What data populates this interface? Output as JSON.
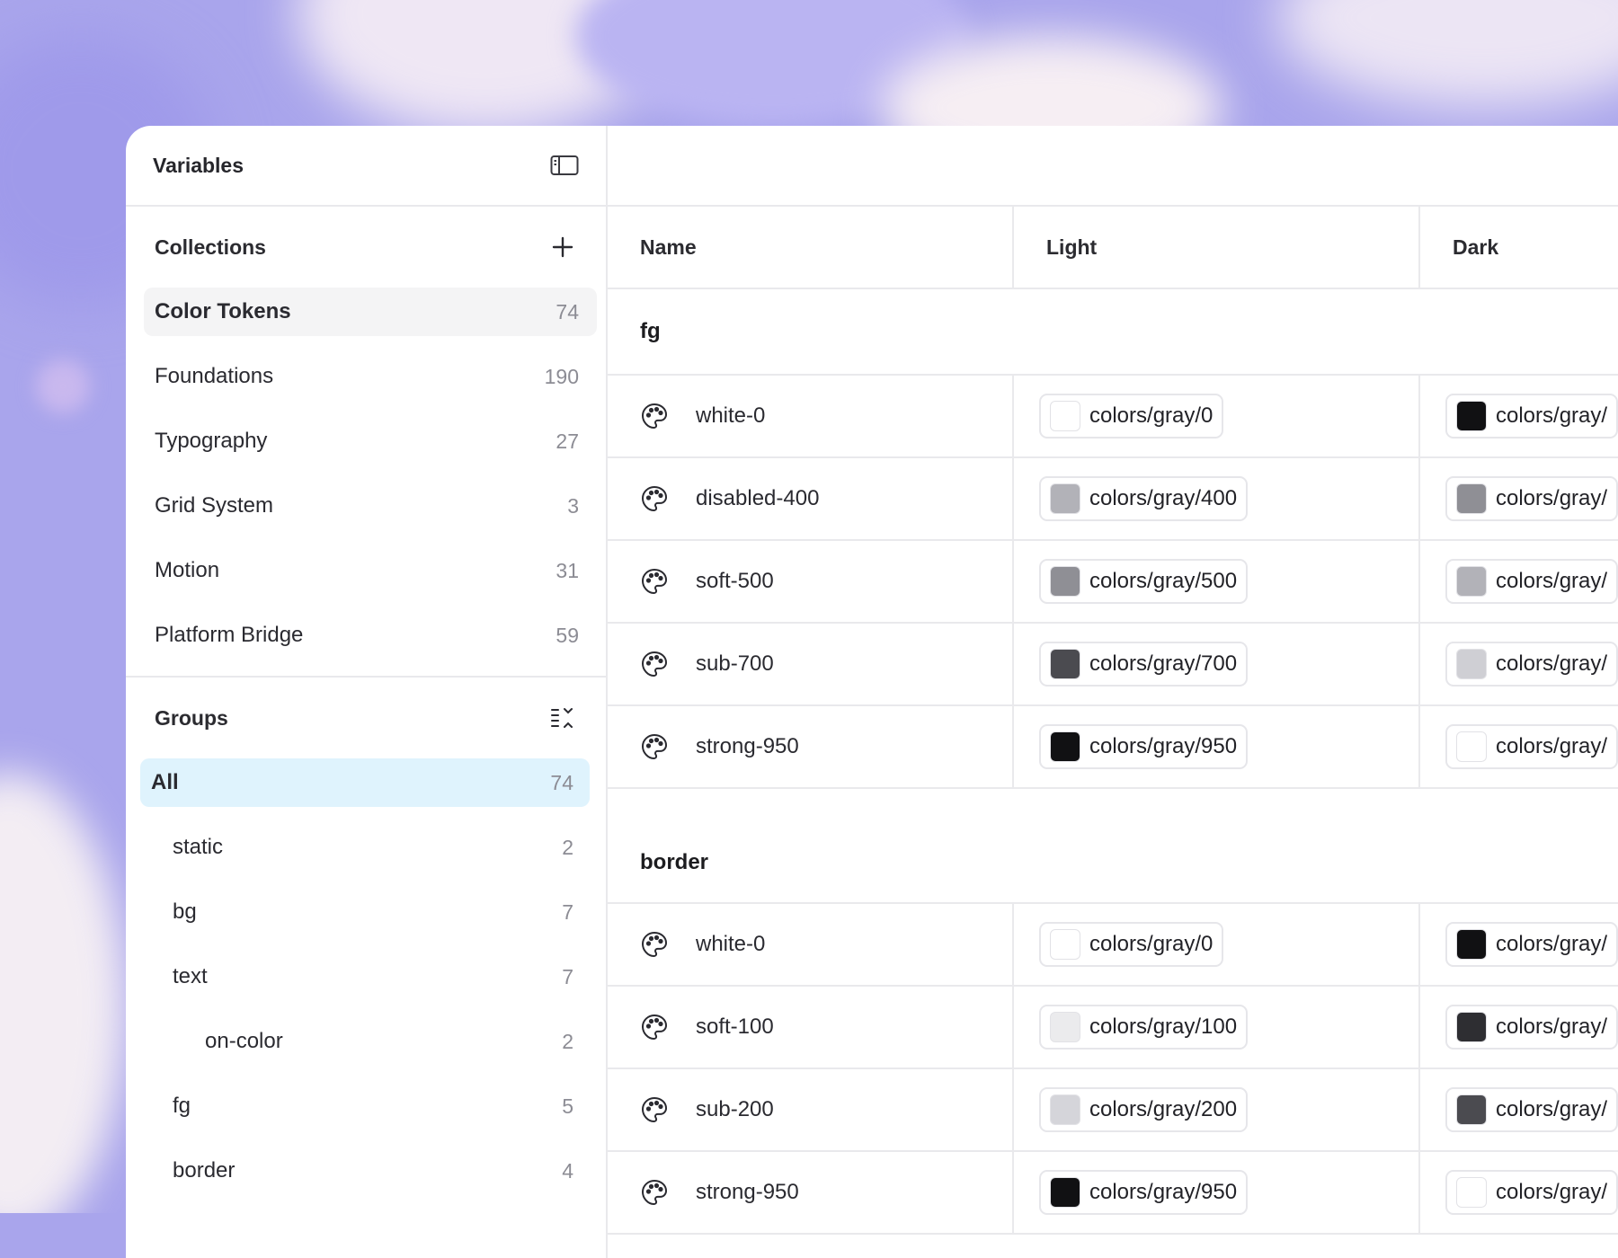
{
  "panel": {
    "title": "Variables"
  },
  "collections": {
    "title": "Collections",
    "items": [
      {
        "label": "Color Tokens",
        "count": "74",
        "active": true
      },
      {
        "label": "Foundations",
        "count": "190"
      },
      {
        "label": "Typography",
        "count": "27"
      },
      {
        "label": "Grid System",
        "count": "3"
      },
      {
        "label": "Motion",
        "count": "31"
      },
      {
        "label": "Platform Bridge",
        "count": "59"
      }
    ]
  },
  "groups": {
    "title": "Groups",
    "items": [
      {
        "label": "All",
        "count": "74",
        "active": true,
        "indent": 0
      },
      {
        "label": "static",
        "count": "2",
        "indent": 1
      },
      {
        "label": "bg",
        "count": "7",
        "indent": 1
      },
      {
        "label": "text",
        "count": "7",
        "indent": 1
      },
      {
        "label": "on-color",
        "count": "2",
        "indent": 2
      },
      {
        "label": "fg",
        "count": "5",
        "indent": 1
      },
      {
        "label": "border",
        "count": "4",
        "indent": 1
      }
    ]
  },
  "table": {
    "columns": [
      "Name",
      "Light",
      "Dark"
    ],
    "groups": [
      {
        "name": "fg",
        "rows": [
          {
            "name": "white-0",
            "light": {
              "label": "colors/gray/0",
              "color": "#ffffff"
            },
            "dark": {
              "label": "colors/gray/",
              "color": "#111113"
            }
          },
          {
            "name": "disabled-400",
            "light": {
              "label": "colors/gray/400",
              "color": "#b2b2b8"
            },
            "dark": {
              "label": "colors/gray/",
              "color": "#8f8f95"
            }
          },
          {
            "name": "soft-500",
            "light": {
              "label": "colors/gray/500",
              "color": "#8f8f95"
            },
            "dark": {
              "label": "colors/gray/",
              "color": "#b2b2b8"
            }
          },
          {
            "name": "sub-700",
            "light": {
              "label": "colors/gray/700",
              "color": "#4b4b50"
            },
            "dark": {
              "label": "colors/gray/",
              "color": "#cfcfd4"
            }
          },
          {
            "name": "strong-950",
            "light": {
              "label": "colors/gray/950",
              "color": "#111113"
            },
            "dark": {
              "label": "colors/gray/",
              "color": "#ffffff"
            }
          }
        ]
      },
      {
        "name": "border",
        "rows": [
          {
            "name": "white-0",
            "light": {
              "label": "colors/gray/0",
              "color": "#ffffff"
            },
            "dark": {
              "label": "colors/gray/",
              "color": "#111113"
            }
          },
          {
            "name": "soft-100",
            "light": {
              "label": "colors/gray/100",
              "color": "#ebebed"
            },
            "dark": {
              "label": "colors/gray/",
              "color": "#2e2e32"
            }
          },
          {
            "name": "sub-200",
            "light": {
              "label": "colors/gray/200",
              "color": "#d5d5da"
            },
            "dark": {
              "label": "colors/gray/",
              "color": "#4b4b50"
            }
          },
          {
            "name": "strong-950",
            "light": {
              "label": "colors/gray/950",
              "color": "#111113"
            },
            "dark": {
              "label": "colors/gray/",
              "color": "#ffffff"
            }
          }
        ]
      }
    ]
  },
  "icons": {
    "sidebar_toggle": "sidebar-toggle-icon",
    "add": "plus-icon",
    "collapse_groups": "collapse-list-icon",
    "row": "palette-icon"
  }
}
